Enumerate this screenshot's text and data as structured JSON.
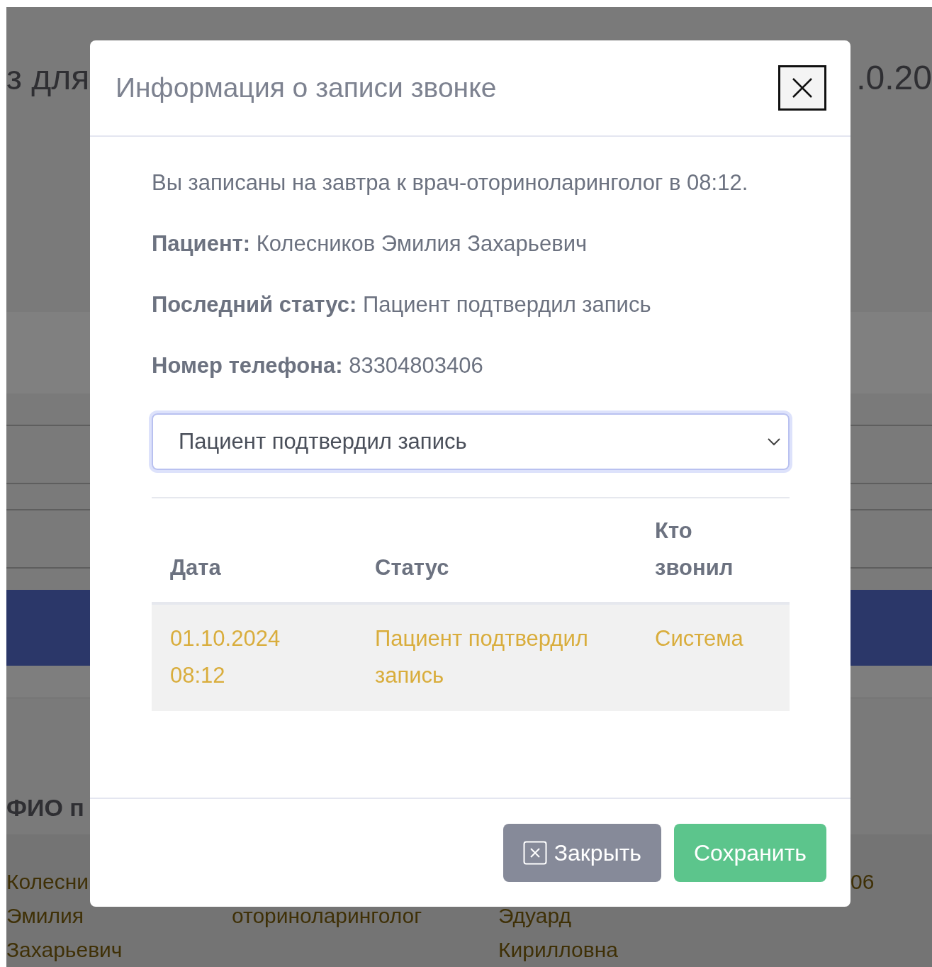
{
  "background": {
    "heading_left": "з для",
    "heading_right": ".0.20",
    "column_header": "ФИО п",
    "rows": [
      {
        "column_1": "Колесни",
        "column_4": "06"
      },
      {
        "column_1": "Эмилия",
        "column_2": "оториноларинголог",
        "column_3": "Эдуард"
      },
      {
        "column_1": "Захарьевич",
        "column_3": "Кирилловна"
      }
    ]
  },
  "dialog": {
    "title": "Информация о записи звонке",
    "message": "Вы записаны на завтра к врач-оториноларинголог в 08:12.",
    "details": [
      "**Пациент:** Колесников Эмилия Захарьевич",
      "**Последний статус:** Пациент подтвердил запись",
      "**Номер телефона:** 83304803406"
    ],
    "status_select": {
      "value": "Пациент подтвердил запись"
    },
    "table": {
      "columns": [
        "Дата",
        "Статус",
        "Кто звонил"
      ],
      "rows": [
        {
          "cells": [
            "01.10.2024 08:12",
            "Пациент подтвердил запись",
            "Система"
          ]
        }
      ]
    },
    "buttons": [
      {
        "label": "Закрыть",
        "kind": "secondary"
      },
      {
        "label": "Сохранить",
        "kind": "primary"
      }
    ]
  }
}
